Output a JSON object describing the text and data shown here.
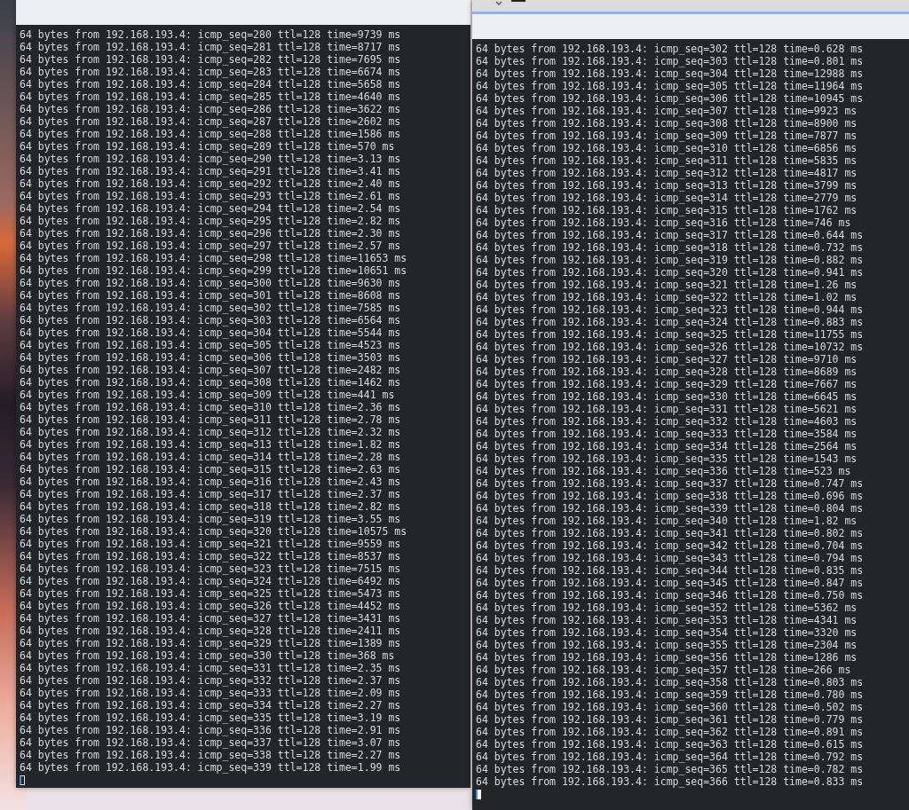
{
  "terminals": [
    {
      "focused": false,
      "lines": [
        "64 bytes from 192.168.193.4: icmp_seq=280 ttl=128 time=9739 ms",
        "64 bytes from 192.168.193.4: icmp_seq=281 ttl=128 time=8717 ms",
        "64 bytes from 192.168.193.4: icmp_seq=282 ttl=128 time=7695 ms",
        "64 bytes from 192.168.193.4: icmp_seq=283 ttl=128 time=6674 ms",
        "64 bytes from 192.168.193.4: icmp_seq=284 ttl=128 time=5658 ms",
        "64 bytes from 192.168.193.4: icmp_seq=285 ttl=128 time=4640 ms",
        "64 bytes from 192.168.193.4: icmp_seq=286 ttl=128 time=3622 ms",
        "64 bytes from 192.168.193.4: icmp_seq=287 ttl=128 time=2602 ms",
        "64 bytes from 192.168.193.4: icmp_seq=288 ttl=128 time=1586 ms",
        "64 bytes from 192.168.193.4: icmp_seq=289 ttl=128 time=570 ms",
        "64 bytes from 192.168.193.4: icmp_seq=290 ttl=128 time=3.13 ms",
        "64 bytes from 192.168.193.4: icmp_seq=291 ttl=128 time=3.41 ms",
        "64 bytes from 192.168.193.4: icmp_seq=292 ttl=128 time=2.40 ms",
        "64 bytes from 192.168.193.4: icmp_seq=293 ttl=128 time=2.61 ms",
        "64 bytes from 192.168.193.4: icmp_seq=294 ttl=128 time=2.54 ms",
        "64 bytes from 192.168.193.4: icmp_seq=295 ttl=128 time=2.82 ms",
        "64 bytes from 192.168.193.4: icmp_seq=296 ttl=128 time=2.30 ms",
        "64 bytes from 192.168.193.4: icmp_seq=297 ttl=128 time=2.57 ms",
        "64 bytes from 192.168.193.4: icmp_seq=298 ttl=128 time=11653 ms",
        "64 bytes from 192.168.193.4: icmp_seq=299 ttl=128 time=10651 ms",
        "64 bytes from 192.168.193.4: icmp_seq=300 ttl=128 time=9630 ms",
        "64 bytes from 192.168.193.4: icmp_seq=301 ttl=128 time=8608 ms",
        "64 bytes from 192.168.193.4: icmp_seq=302 ttl=128 time=7585 ms",
        "64 bytes from 192.168.193.4: icmp_seq=303 ttl=128 time=6564 ms",
        "64 bytes from 192.168.193.4: icmp_seq=304 ttl=128 time=5544 ms",
        "64 bytes from 192.168.193.4: icmp_seq=305 ttl=128 time=4523 ms",
        "64 bytes from 192.168.193.4: icmp_seq=306 ttl=128 time=3503 ms",
        "64 bytes from 192.168.193.4: icmp_seq=307 ttl=128 time=2482 ms",
        "64 bytes from 192.168.193.4: icmp_seq=308 ttl=128 time=1462 ms",
        "64 bytes from 192.168.193.4: icmp_seq=309 ttl=128 time=441 ms",
        "64 bytes from 192.168.193.4: icmp_seq=310 ttl=128 time=2.36 ms",
        "64 bytes from 192.168.193.4: icmp_seq=311 ttl=128 time=2.78 ms",
        "64 bytes from 192.168.193.4: icmp_seq=312 ttl=128 time=2.32 ms",
        "64 bytes from 192.168.193.4: icmp_seq=313 ttl=128 time=1.82 ms",
        "64 bytes from 192.168.193.4: icmp_seq=314 ttl=128 time=2.28 ms",
        "64 bytes from 192.168.193.4: icmp_seq=315 ttl=128 time=2.63 ms",
        "64 bytes from 192.168.193.4: icmp_seq=316 ttl=128 time=2.43 ms",
        "64 bytes from 192.168.193.4: icmp_seq=317 ttl=128 time=2.37 ms",
        "64 bytes from 192.168.193.4: icmp_seq=318 ttl=128 time=2.82 ms",
        "64 bytes from 192.168.193.4: icmp_seq=319 ttl=128 time=3.55 ms",
        "64 bytes from 192.168.193.4: icmp_seq=320 ttl=128 time=10575 ms",
        "64 bytes from 192.168.193.4: icmp_seq=321 ttl=128 time=9559 ms",
        "64 bytes from 192.168.193.4: icmp_seq=322 ttl=128 time=8537 ms",
        "64 bytes from 192.168.193.4: icmp_seq=323 ttl=128 time=7515 ms",
        "64 bytes from 192.168.193.4: icmp_seq=324 ttl=128 time=6492 ms",
        "64 bytes from 192.168.193.4: icmp_seq=325 ttl=128 time=5473 ms",
        "64 bytes from 192.168.193.4: icmp_seq=326 ttl=128 time=4452 ms",
        "64 bytes from 192.168.193.4: icmp_seq=327 ttl=128 time=3431 ms",
        "64 bytes from 192.168.193.4: icmp_seq=328 ttl=128 time=2411 ms",
        "64 bytes from 192.168.193.4: icmp_seq=329 ttl=128 time=1389 ms",
        "64 bytes from 192.168.193.4: icmp_seq=330 ttl=128 time=368 ms",
        "64 bytes from 192.168.193.4: icmp_seq=331 ttl=128 time=2.35 ms",
        "64 bytes from 192.168.193.4: icmp_seq=332 ttl=128 time=2.37 ms",
        "64 bytes from 192.168.193.4: icmp_seq=333 ttl=128 time=2.09 ms",
        "64 bytes from 192.168.193.4: icmp_seq=334 ttl=128 time=2.27 ms",
        "64 bytes from 192.168.193.4: icmp_seq=335 ttl=128 time=3.19 ms",
        "64 bytes from 192.168.193.4: icmp_seq=336 ttl=128 time=2.91 ms",
        "64 bytes from 192.168.193.4: icmp_seq=337 ttl=128 time=3.07 ms",
        "64 bytes from 192.168.193.4: icmp_seq=338 ttl=128 time=2.27 ms",
        "64 bytes from 192.168.193.4: icmp_seq=339 ttl=128 time=1.99 ms"
      ]
    },
    {
      "focused": true,
      "lines": [
        "64 bytes from 192.168.193.4: icmp_seq=302 ttl=128 time=0.628 ms",
        "64 bytes from 192.168.193.4: icmp_seq=303 ttl=128 time=0.801 ms",
        "64 bytes from 192.168.193.4: icmp_seq=304 ttl=128 time=12988 ms",
        "64 bytes from 192.168.193.4: icmp_seq=305 ttl=128 time=11964 ms",
        "64 bytes from 192.168.193.4: icmp_seq=306 ttl=128 time=10945 ms",
        "64 bytes from 192.168.193.4: icmp_seq=307 ttl=128 time=9923 ms",
        "64 bytes from 192.168.193.4: icmp_seq=308 ttl=128 time=8900 ms",
        "64 bytes from 192.168.193.4: icmp_seq=309 ttl=128 time=7877 ms",
        "64 bytes from 192.168.193.4: icmp_seq=310 ttl=128 time=6856 ms",
        "64 bytes from 192.168.193.4: icmp_seq=311 ttl=128 time=5835 ms",
        "64 bytes from 192.168.193.4: icmp_seq=312 ttl=128 time=4817 ms",
        "64 bytes from 192.168.193.4: icmp_seq=313 ttl=128 time=3799 ms",
        "64 bytes from 192.168.193.4: icmp_seq=314 ttl=128 time=2779 ms",
        "64 bytes from 192.168.193.4: icmp_seq=315 ttl=128 time=1762 ms",
        "64 bytes from 192.168.193.4: icmp_seq=316 ttl=128 time=746 ms",
        "64 bytes from 192.168.193.4: icmp_seq=317 ttl=128 time=0.644 ms",
        "64 bytes from 192.168.193.4: icmp_seq=318 ttl=128 time=0.732 ms",
        "64 bytes from 192.168.193.4: icmp_seq=319 ttl=128 time=0.882 ms",
        "64 bytes from 192.168.193.4: icmp_seq=320 ttl=128 time=0.941 ms",
        "64 bytes from 192.168.193.4: icmp_seq=321 ttl=128 time=1.26 ms",
        "64 bytes from 192.168.193.4: icmp_seq=322 ttl=128 time=1.02 ms",
        "64 bytes from 192.168.193.4: icmp_seq=323 ttl=128 time=0.944 ms",
        "64 bytes from 192.168.193.4: icmp_seq=324 ttl=128 time=0.883 ms",
        "64 bytes from 192.168.193.4: icmp_seq=325 ttl=128 time=11755 ms",
        "64 bytes from 192.168.193.4: icmp_seq=326 ttl=128 time=10732 ms",
        "64 bytes from 192.168.193.4: icmp_seq=327 ttl=128 time=9710 ms",
        "64 bytes from 192.168.193.4: icmp_seq=328 ttl=128 time=8689 ms",
        "64 bytes from 192.168.193.4: icmp_seq=329 ttl=128 time=7667 ms",
        "64 bytes from 192.168.193.4: icmp_seq=330 ttl=128 time=6645 ms",
        "64 bytes from 192.168.193.4: icmp_seq=331 ttl=128 time=5621 ms",
        "64 bytes from 192.168.193.4: icmp_seq=332 ttl=128 time=4603 ms",
        "64 bytes from 192.168.193.4: icmp_seq=333 ttl=128 time=3584 ms",
        "64 bytes from 192.168.193.4: icmp_seq=334 ttl=128 time=2564 ms",
        "64 bytes from 192.168.193.4: icmp_seq=335 ttl=128 time=1543 ms",
        "64 bytes from 192.168.193.4: icmp_seq=336 ttl=128 time=523 ms",
        "64 bytes from 192.168.193.4: icmp_seq=337 ttl=128 time=0.747 ms",
        "64 bytes from 192.168.193.4: icmp_seq=338 ttl=128 time=0.696 ms",
        "64 bytes from 192.168.193.4: icmp_seq=339 ttl=128 time=0.804 ms",
        "64 bytes from 192.168.193.4: icmp_seq=340 ttl=128 time=1.82 ms",
        "64 bytes from 192.168.193.4: icmp_seq=341 ttl=128 time=0.802 ms",
        "64 bytes from 192.168.193.4: icmp_seq=342 ttl=128 time=0.704 ms",
        "64 bytes from 192.168.193.4: icmp_seq=343 ttl=128 time=0.794 ms",
        "64 bytes from 192.168.193.4: icmp_seq=344 ttl=128 time=0.835 ms",
        "64 bytes from 192.168.193.4: icmp_seq=345 ttl=128 time=0.847 ms",
        "64 bytes from 192.168.193.4: icmp_seq=346 ttl=128 time=0.750 ms",
        "64 bytes from 192.168.193.4: icmp_seq=352 ttl=128 time=5362 ms",
        "64 bytes from 192.168.193.4: icmp_seq=353 ttl=128 time=4341 ms",
        "64 bytes from 192.168.193.4: icmp_seq=354 ttl=128 time=3320 ms",
        "64 bytes from 192.168.193.4: icmp_seq=355 ttl=128 time=2304 ms",
        "64 bytes from 192.168.193.4: icmp_seq=356 ttl=128 time=1286 ms",
        "64 bytes from 192.168.193.4: icmp_seq=357 ttl=128 time=266 ms",
        "64 bytes from 192.168.193.4: icmp_seq=358 ttl=128 time=0.803 ms",
        "64 bytes from 192.168.193.4: icmp_seq=359 ttl=128 time=0.780 ms",
        "64 bytes from 192.168.193.4: icmp_seq=360 ttl=128 time=0.502 ms",
        "64 bytes from 192.168.193.4: icmp_seq=361 ttl=128 time=0.779 ms",
        "64 bytes from 192.168.193.4: icmp_seq=362 ttl=128 time=0.891 ms",
        "64 bytes from 192.168.193.4: icmp_seq=363 ttl=128 time=0.615 ms",
        "64 bytes from 192.168.193.4: icmp_seq=364 ttl=128 time=0.792 ms",
        "64 bytes from 192.168.193.4: icmp_seq=365 ttl=128 time=0.782 ms",
        "64 bytes from 192.168.193.4: icmp_seq=366 ttl=128 time=0.833 ms"
      ]
    }
  ]
}
